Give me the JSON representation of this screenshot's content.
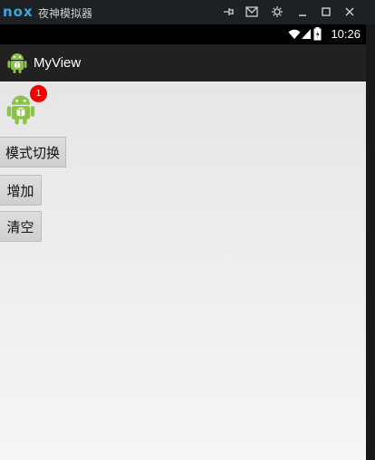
{
  "emulator": {
    "logo": "nox",
    "title": "夜神模拟器",
    "controls": [
      "pin-icon",
      "mail-icon",
      "gear-icon",
      "minimize-icon",
      "maximize-icon",
      "close-icon"
    ]
  },
  "status_bar": {
    "time": "10:26"
  },
  "action_bar": {
    "title": "MyView"
  },
  "content": {
    "badge_count": "1",
    "buttons": [
      {
        "label": "模式切换"
      },
      {
        "label": "增加"
      },
      {
        "label": "清空"
      }
    ]
  },
  "colors": {
    "badge": "#f20000",
    "android_green": "#8bc34a",
    "action_bar": "#212121"
  }
}
